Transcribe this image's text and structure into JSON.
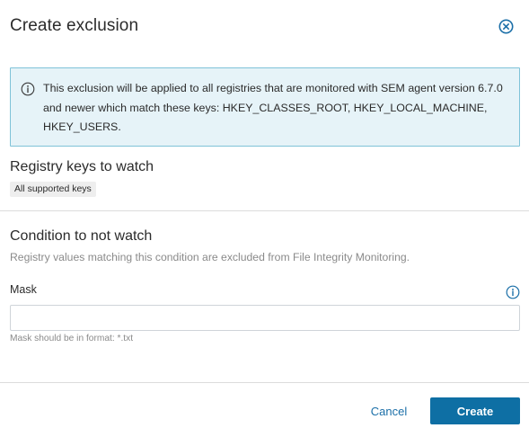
{
  "dialog": {
    "title": "Create exclusion",
    "close_icon": "close-circle-icon"
  },
  "alert": {
    "icon": "info-icon",
    "text": "This exclusion will be applied to all registries that are monitored with SEM agent version 6.7.0 and newer which match these keys: HKEY_CLASSES_ROOT, HKEY_LOCAL_MACHINE, HKEY_USERS."
  },
  "registry_section": {
    "title": "Registry keys to watch",
    "tag": "All supported keys"
  },
  "condition_section": {
    "title": "Condition to not watch",
    "description": "Registry values matching this condition are excluded from File Integrity Monitoring.",
    "mask": {
      "label": "Mask",
      "value": "",
      "placeholder": "",
      "hint": "Mask should be in format: *.txt",
      "info_icon": "info-icon"
    }
  },
  "footer": {
    "cancel_label": "Cancel",
    "create_label": "Create"
  },
  "colors": {
    "accent": "#0e6fa4",
    "link": "#1b6fa8",
    "alert_background": "#e6f3f8",
    "alert_border": "#7fc3d8"
  }
}
